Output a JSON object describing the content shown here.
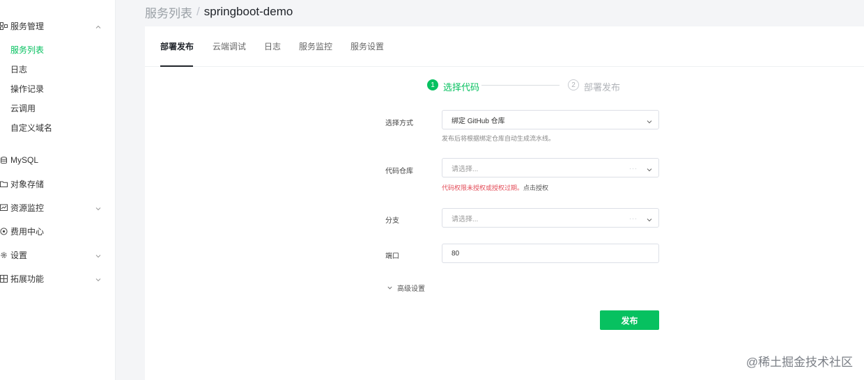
{
  "sidebar": {
    "groups": [
      {
        "label": "服务管理",
        "icon": "service-grid-icon"
      },
      {
        "label": "MySQL",
        "icon": "database-icon"
      },
      {
        "label": "对象存储",
        "icon": "folder-icon"
      },
      {
        "label": "资源监控",
        "icon": "monitor-chart-icon"
      },
      {
        "label": "费用中心",
        "icon": "coin-icon"
      },
      {
        "label": "设置",
        "icon": "gear-icon"
      },
      {
        "label": "拓展功能",
        "icon": "extension-icon"
      }
    ],
    "sub_items": [
      "服务列表",
      "日志",
      "操作记录",
      "云调用",
      "自定义域名"
    ],
    "active_sub": "服务列表"
  },
  "header": {
    "parent": "服务列表",
    "separator": "/",
    "current": "springboot-demo"
  },
  "tabs": [
    "部署发布",
    "云端调试",
    "日志",
    "服务监控",
    "服务设置"
  ],
  "active_tab": "部署发布",
  "steps": [
    {
      "num": "1",
      "label": "选择代码",
      "state": "done"
    },
    {
      "num": "2",
      "label": "部署发布",
      "state": "todo"
    }
  ],
  "form": {
    "method": {
      "label": "选择方式",
      "value": "绑定 GitHub 仓库",
      "hint": "发布后将根据绑定仓库自动生成流水线。"
    },
    "repo": {
      "label": "代码仓库",
      "placeholder": "请选择...",
      "dots": "···",
      "error": "代码权限未授权或授权过期。",
      "error_link": "点击授权"
    },
    "branch": {
      "label": "分支",
      "placeholder": "请选择...",
      "dots": "···"
    },
    "port": {
      "label": "端口",
      "value": "80"
    },
    "advanced": "高级设置",
    "submit": "发布"
  },
  "watermark": "@稀土掘金技术社区",
  "colors": {
    "accent": "#07c160",
    "error": "#e34d59"
  }
}
